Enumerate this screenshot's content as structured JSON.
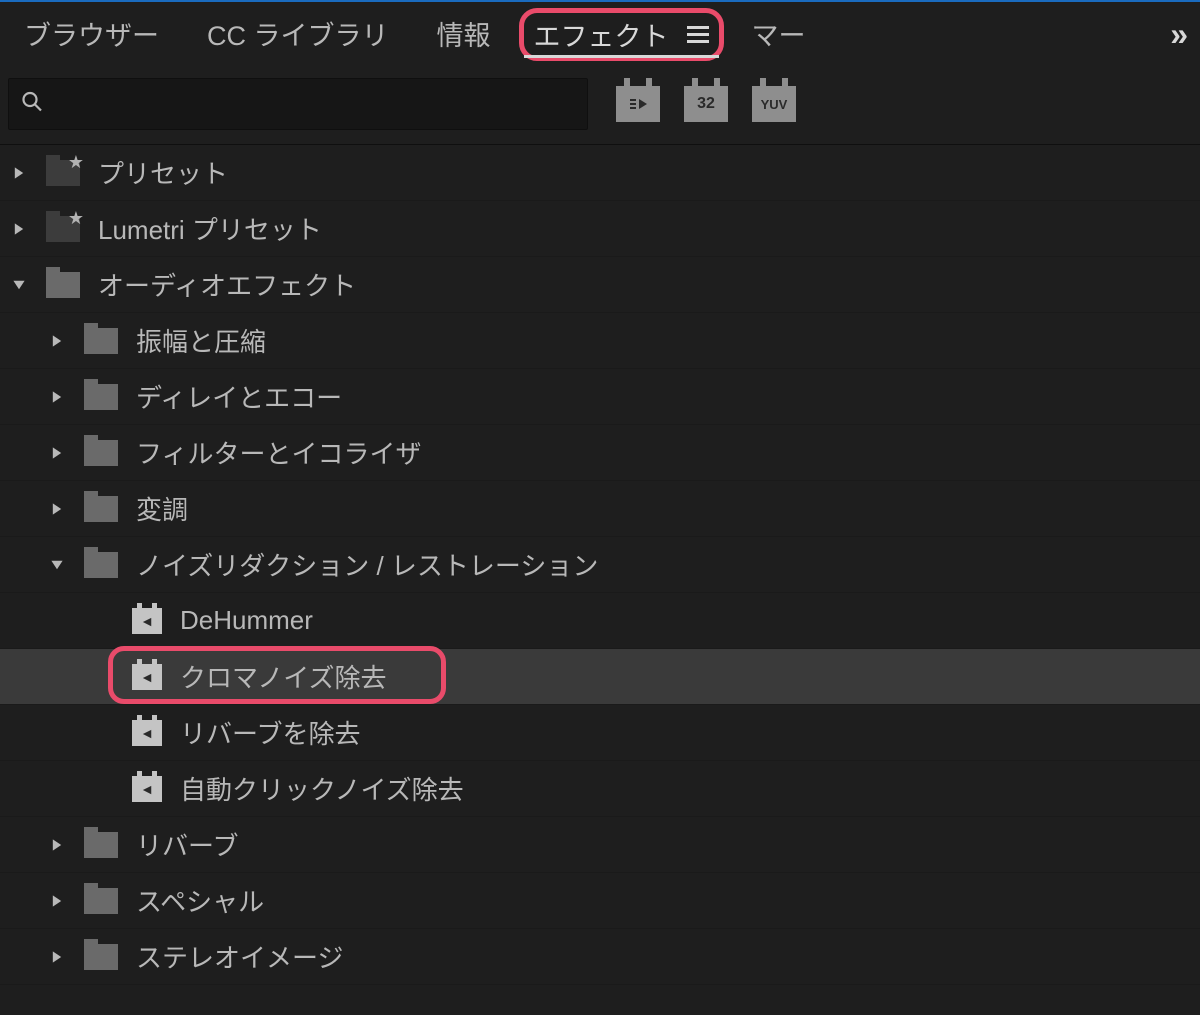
{
  "tabs": {
    "browser": "ブラウザー",
    "cc_library": "CC ライブラリ",
    "info": "情報",
    "effects": "エフェクト",
    "markers_trunc": "マー"
  },
  "search": {
    "value": ""
  },
  "filter_badges": {
    "accelerated": "▸▸",
    "thirty_two": "32",
    "yuv": "YUV"
  },
  "tree": {
    "presets": "プリセット",
    "lumetri_presets": "Lumetri プリセット",
    "audio_effects": "オーディオエフェクト",
    "amplitude": "振幅と圧縮",
    "delay": "ディレイとエコー",
    "filter_eq": "フィルターとイコライザ",
    "modulation": "変調",
    "noise_reduction": "ノイズリダクション / レストレーション",
    "dehummer": "DeHummer",
    "chroma_noise": "クロマノイズ除去",
    "reverb_remove": "リバーブを除去",
    "auto_click": "自動クリックノイズ除去",
    "reverb": "リバーブ",
    "special": "スペシャル",
    "stereo_image": "ステレオイメージ"
  },
  "highlights": {
    "tab": "effects",
    "item": "chroma_noise"
  }
}
